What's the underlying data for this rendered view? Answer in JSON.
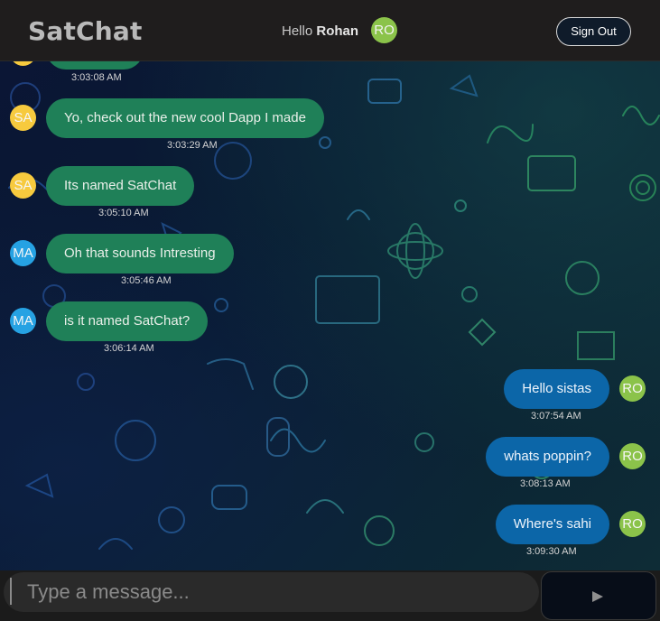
{
  "header": {
    "app_title": "SatChat",
    "greeting_prefix": "Hello ",
    "user_name": "Rohan",
    "user_initials": "RO",
    "sign_out_label": "Sign Out"
  },
  "messages": [
    {
      "sender": "SA",
      "text": "",
      "time": "3:03:08 AM",
      "side": "received"
    },
    {
      "sender": "SA",
      "text": "Yo, check out the new cool Dapp I made",
      "time": "3:03:29 AM",
      "side": "received"
    },
    {
      "sender": "SA",
      "text": "Its named SatChat",
      "time": "3:05:10 AM",
      "side": "received"
    },
    {
      "sender": "MA",
      "text": "Oh that sounds Intresting",
      "time": "3:05:46 AM",
      "side": "received"
    },
    {
      "sender": "MA",
      "text": "is it named SatChat?",
      "time": "3:06:14 AM",
      "side": "received"
    },
    {
      "sender": "RO",
      "text": "Hello sistas",
      "time": "3:07:54 AM",
      "side": "sent"
    },
    {
      "sender": "RO",
      "text": "whats poppin?",
      "time": "3:08:13 AM",
      "side": "sent"
    },
    {
      "sender": "RO",
      "text": "Where's sahi",
      "time": "3:09:30 AM",
      "side": "sent"
    }
  ],
  "composer": {
    "placeholder": "Type a message...",
    "send_icon": "send-triangle-icon"
  },
  "colors": {
    "received_bubble": "#1f8058",
    "sent_bubble": "#0c66a8",
    "avatar_sa": "#f7ca3e",
    "avatar_ma": "#26a2e3",
    "avatar_ro": "#8bc34a"
  }
}
